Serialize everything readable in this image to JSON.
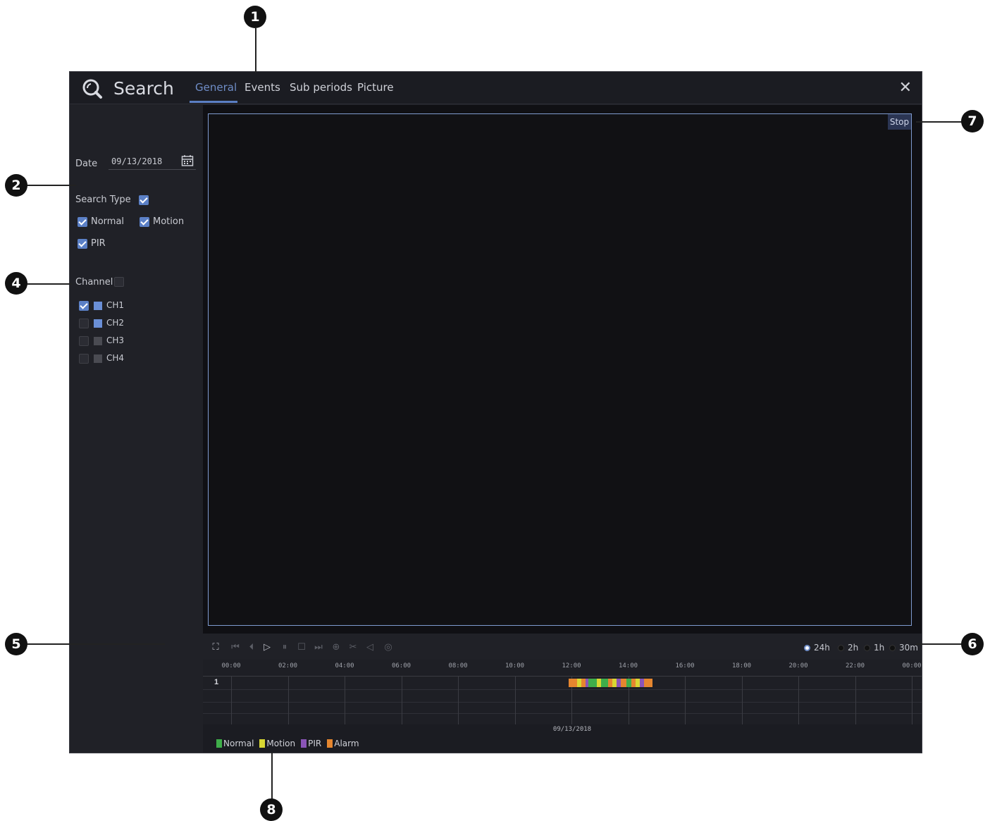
{
  "header": {
    "title": "Search",
    "tabs": [
      {
        "label": "General",
        "active": true
      },
      {
        "label": "Events",
        "active": false
      },
      {
        "label": "Sub periods",
        "active": false
      },
      {
        "label": "Picture",
        "active": false
      }
    ],
    "close": "✕"
  },
  "left": {
    "date_label": "Date",
    "date_value": "09/13/2018",
    "search_type_label": "Search Type",
    "search_type_all": true,
    "types": [
      {
        "label": "Normal",
        "checked": true
      },
      {
        "label": "Motion",
        "checked": true
      },
      {
        "label": "PIR",
        "checked": true
      }
    ],
    "channel_label": "Channel",
    "channel_all": false,
    "channels": [
      {
        "label": "CH1",
        "checked": true,
        "color": "#6a8fd6"
      },
      {
        "label": "CH2",
        "checked": false,
        "color": "#6a8fd6"
      },
      {
        "label": "CH3",
        "checked": false,
        "color": "#4a4b52"
      },
      {
        "label": "CH4",
        "checked": false,
        "color": "#4a4b52"
      }
    ]
  },
  "video": {
    "stop_label": "Stop"
  },
  "controls": {
    "buttons": [
      "fullscreen-icon",
      "rewind-icon",
      "step-back-icon",
      "play-icon",
      "pause-icon",
      "stop-icon",
      "fast-forward-icon",
      "snapshot-icon",
      "clip-icon",
      "volume-icon",
      "record-icon"
    ],
    "zoom": [
      {
        "label": "24h",
        "selected": true
      },
      {
        "label": "2h",
        "selected": false
      },
      {
        "label": "1h",
        "selected": false
      },
      {
        "label": "30m",
        "selected": false
      }
    ]
  },
  "timeline": {
    "ticks": [
      "00:00",
      "02:00",
      "04:00",
      "06:00",
      "08:00",
      "10:00",
      "12:00",
      "14:00",
      "16:00",
      "18:00",
      "20:00",
      "22:00",
      "00:00"
    ],
    "row_label": "1",
    "date": "09/13/2018",
    "segments": [
      {
        "start": 11.9,
        "end": 12.2,
        "type": "Alarm"
      },
      {
        "start": 12.2,
        "end": 12.35,
        "type": "Motion"
      },
      {
        "start": 12.35,
        "end": 12.5,
        "type": "Alarm"
      },
      {
        "start": 12.5,
        "end": 12.6,
        "type": "PIR"
      },
      {
        "start": 12.6,
        "end": 12.9,
        "type": "Normal"
      },
      {
        "start": 12.9,
        "end": 13.05,
        "type": "Motion"
      },
      {
        "start": 13.05,
        "end": 13.3,
        "type": "Normal"
      },
      {
        "start": 13.3,
        "end": 13.45,
        "type": "Alarm"
      },
      {
        "start": 13.45,
        "end": 13.6,
        "type": "Motion"
      },
      {
        "start": 13.6,
        "end": 13.75,
        "type": "PIR"
      },
      {
        "start": 13.75,
        "end": 13.95,
        "type": "Alarm"
      },
      {
        "start": 13.95,
        "end": 14.1,
        "type": "Normal"
      },
      {
        "start": 14.1,
        "end": 14.25,
        "type": "Alarm"
      },
      {
        "start": 14.25,
        "end": 14.4,
        "type": "Motion"
      },
      {
        "start": 14.4,
        "end": 14.55,
        "type": "PIR"
      },
      {
        "start": 14.55,
        "end": 14.85,
        "type": "Alarm"
      }
    ],
    "legend": [
      {
        "label": "Normal",
        "color": "#3fae4a"
      },
      {
        "label": "Motion",
        "color": "#d8d733"
      },
      {
        "label": "PIR",
        "color": "#8a55b8"
      },
      {
        "label": "Alarm",
        "color": "#e5862f"
      }
    ]
  },
  "callouts": [
    "1",
    "2",
    "4",
    "5",
    "6",
    "7",
    "8"
  ]
}
